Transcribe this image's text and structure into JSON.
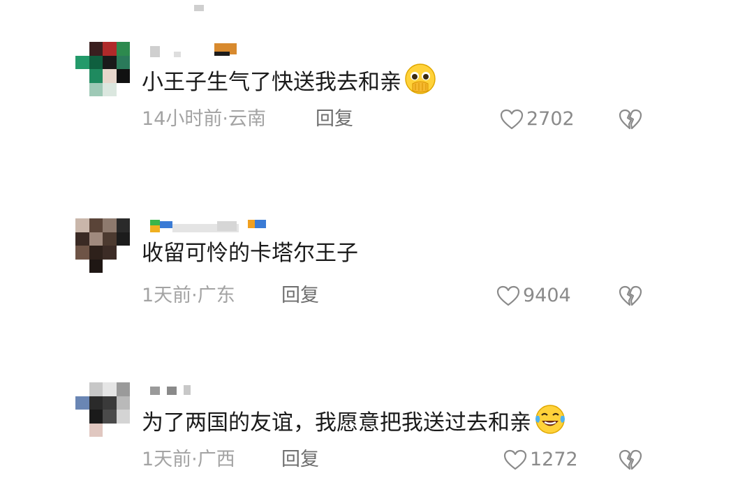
{
  "comments": [
    {
      "text": "小王子生气了快送我去和亲",
      "emoji_icon": "pleading-face-icon",
      "meta": "14小时前·云南",
      "reply": "回复",
      "likes": "2702"
    },
    {
      "text": "收留可怜的卡塔尔王子",
      "meta": "1天前·广东",
      "reply": "回复",
      "likes": "9404"
    },
    {
      "text": "为了两国的友谊，我愿意把我送过去和亲",
      "emoji_icon": "tears-of-joy-icon",
      "meta": "1天前·广西",
      "reply": "回复",
      "likes": "1272"
    }
  ],
  "icons": {
    "like": "heart-outline-icon",
    "dislike": "broken-heart-icon"
  },
  "colors": {
    "text": "#1a1a1a",
    "meta": "#a3a3a3",
    "icon": "#8a8a8a"
  }
}
